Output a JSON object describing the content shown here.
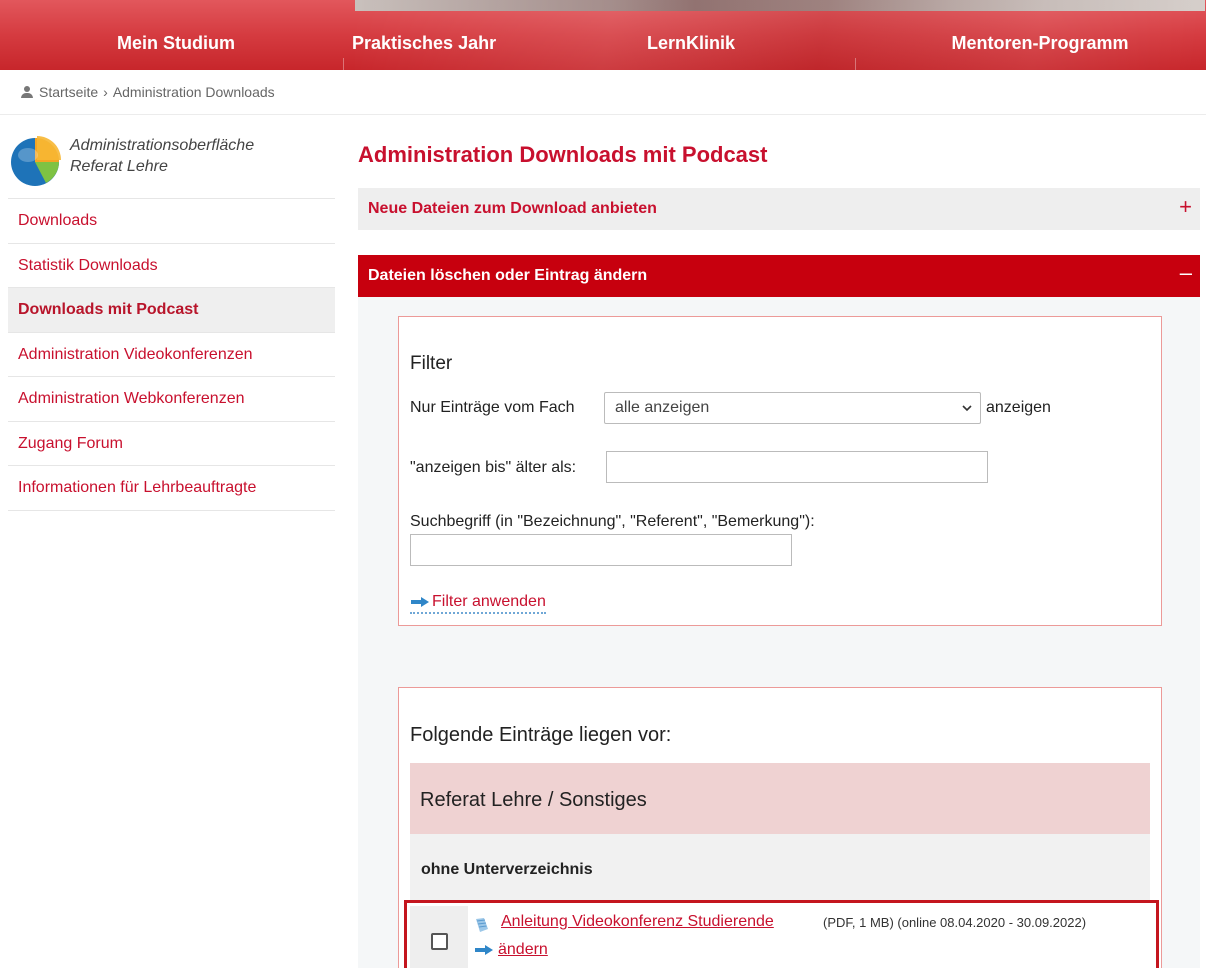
{
  "nav": {
    "items": [
      {
        "label": "Mein Studium"
      },
      {
        "label": "Praktisches Jahr"
      },
      {
        "label": "LernKlinik"
      },
      {
        "label": "Mentoren-Programm"
      }
    ]
  },
  "breadcrumb": {
    "home": "Startseite",
    "separator": "›",
    "current": "Administration Downloads"
  },
  "sidebar": {
    "title_line1": "Administrationsoberfläche",
    "title_line2": "Referat Lehre",
    "items": [
      {
        "label": "Downloads",
        "active": false
      },
      {
        "label": "Statistik Downloads",
        "active": false
      },
      {
        "label": "Downloads mit Podcast",
        "active": true
      },
      {
        "label": "Administration Videokonferenzen",
        "active": false
      },
      {
        "label": "Administration Webkonferenzen",
        "active": false
      },
      {
        "label": "Zugang Forum",
        "active": false
      },
      {
        "label": "Informationen für Lehrbeauftragte",
        "active": false
      }
    ]
  },
  "main": {
    "title": "Administration Downloads mit Podcast",
    "accordion_new": {
      "label": "Neue Dateien zum Download anbieten",
      "toggle": "+"
    },
    "accordion_manage": {
      "label": "Dateien löschen oder Eintrag ändern",
      "toggle": "–"
    },
    "filter": {
      "title": "Filter",
      "subject_label": "Nur Einträge vom Fach",
      "subject_value": "alle anzeigen",
      "subject_suffix": "anzeigen",
      "older_label": "\"anzeigen bis\" älter als:",
      "older_value": "",
      "search_label": "Suchbegriff (in \"Bezeichnung\", \"Referent\", \"Bemerkung\"):",
      "search_value": "",
      "apply_label": "Filter anwenden"
    },
    "entries": {
      "title": "Folgende Einträge liegen vor:",
      "group": "Referat Lehre / Sonstiges",
      "subdir": "ohne Unterverzeichnis",
      "items": [
        {
          "name": "Anleitung Videokonferenz Studierende",
          "meta": "(PDF, 1 MB) (online 08.04.2020 - 30.09.2022)",
          "edit_label": "ändern",
          "checked": false
        }
      ]
    }
  },
  "colors": {
    "accent": "#c8102e",
    "nav_red": "#d53b40",
    "accordion_active": "#c7000e",
    "group_bg": "#efd2d2"
  },
  "icons": [
    "user-icon",
    "pie-chart-icon",
    "chevron-down-icon",
    "arrow-right-icon",
    "document-icon",
    "plus-icon",
    "minus-icon"
  ]
}
